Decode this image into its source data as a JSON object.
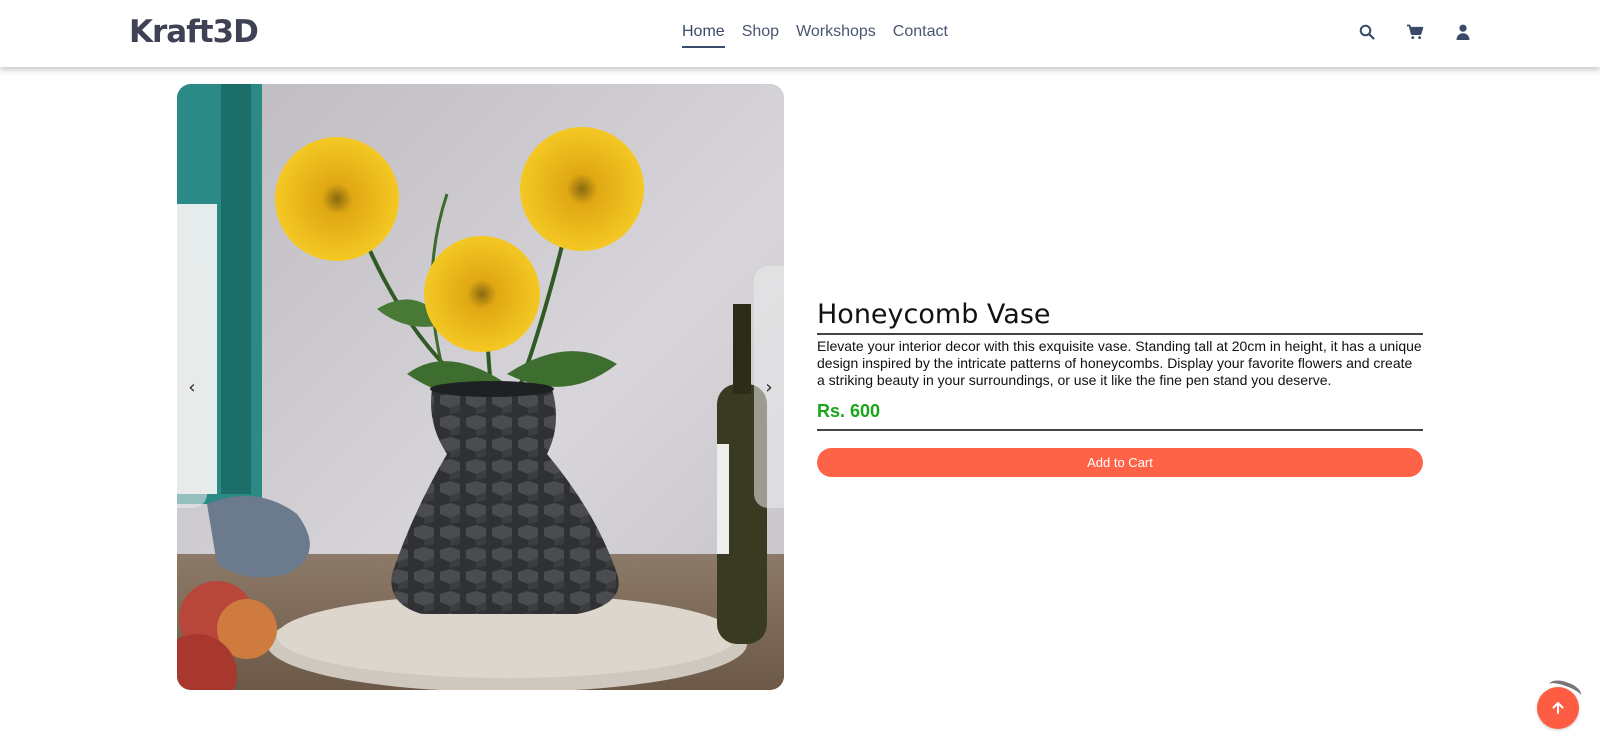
{
  "brand": {
    "logo_text": "Kraft3D"
  },
  "nav": {
    "items": [
      {
        "label": "Home",
        "active": true
      },
      {
        "label": "Shop",
        "active": false
      },
      {
        "label": "Workshops",
        "active": false
      },
      {
        "label": "Contact",
        "active": false
      }
    ]
  },
  "header_icons": [
    "search-icon",
    "cart-icon",
    "user-icon"
  ],
  "carousel": {
    "prev_icon": "chevron-left-icon",
    "next_icon": "chevron-right-icon",
    "prev_glyph": "‹",
    "next_glyph": "›"
  },
  "product": {
    "title": "Honeycomb Vase",
    "description": "Elevate your interior decor with this exquisite vase. Standing tall at 20cm in height, it has a unique design inspired by the intricate patterns of honeycombs. Display your favorite flowers and create a striking beauty in your surroundings, or use it like the fine pen stand you deserve.",
    "price": "Rs. 600",
    "add_to_cart_label": "Add to Cart"
  },
  "colors": {
    "accent": "#ff6347",
    "price": "#1aa51a",
    "nav_text": "#4a5570"
  },
  "back_to_top_icon": "arrow-up-icon"
}
